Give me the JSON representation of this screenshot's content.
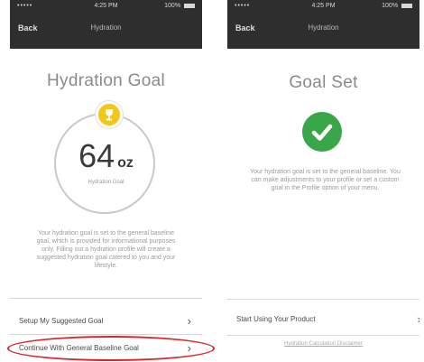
{
  "screens": [
    {
      "status": {
        "signal": "•••••",
        "time": "4:25 PM",
        "battery": "100%"
      },
      "nav": {
        "back_label": "Back",
        "title": "Hydration"
      },
      "title": "Hydration Goal",
      "goal": {
        "value": "64",
        "unit": "oz",
        "caption": "Hydration Goal"
      },
      "body": "Your hydration goal is set to the general baseline goal, which is provided for informational purposes only. Filling out a hydration profile will create a suggested hydration goal catered to you and your lifestyle.",
      "options": [
        {
          "label": "Setup My Suggested Goal"
        },
        {
          "label": "Continue With General Baseline Goal"
        }
      ],
      "icons": {
        "trophy": "trophy-icon",
        "chevron": "chevron-right-icon"
      }
    },
    {
      "status": {
        "signal": "•••••",
        "time": "4:25 PM",
        "battery": "100%"
      },
      "nav": {
        "back_label": "Back",
        "title": "Hydration"
      },
      "title": "Goal Set",
      "body": "Your hydration goal is set to the general baseline. You can make adjustments to your profile or set a custom goal in the Profile option of your menu.",
      "options": [
        {
          "label": "Start Using Your Product"
        }
      ],
      "footer_link": "Hydration Calculation Disclaimer",
      "icons": {
        "check": "checkmark-icon",
        "chevron": "chevron-right-icon"
      }
    }
  ],
  "colors": {
    "nav_bg": "#2e2e2e",
    "check_green": "#3aa64a",
    "trophy_gold": "#f5c518",
    "highlight_red": "#d9262c"
  }
}
